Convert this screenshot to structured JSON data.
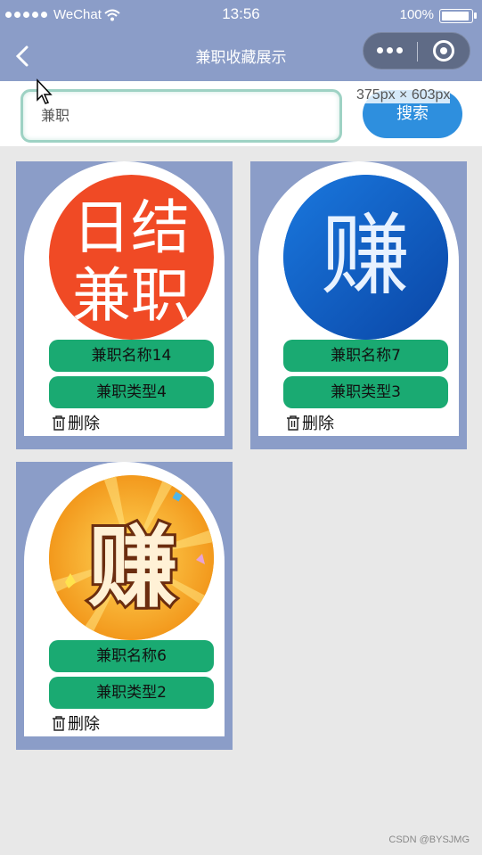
{
  "status_bar": {
    "carrier": "WeChat",
    "time": "13:56",
    "battery": "100%",
    "battery_level": 1.0,
    "icons": [
      "signal-dots-icon",
      "wifi-icon",
      "battery-icon"
    ]
  },
  "nav": {
    "title": "兼职收藏展示",
    "icons": [
      "back-icon",
      "more-icon",
      "close-icon"
    ]
  },
  "search": {
    "value": "兼职",
    "button_label": "搜索",
    "dim_label": "375px × 603px"
  },
  "items": [
    {
      "name": "兼职名称14",
      "type": "兼职类型4",
      "delete_label": "删除",
      "image_text": [
        "日结",
        "兼职"
      ],
      "image_bg": "#f04a25"
    },
    {
      "name": "兼职名称7",
      "type": "兼职类型3",
      "delete_label": "删除",
      "image_text": [
        "赚"
      ],
      "image_bg": "#0d5fc6"
    },
    {
      "name": "兼职名称6",
      "type": "兼职类型2",
      "delete_label": "删除",
      "image_text": [
        "赚"
      ],
      "image_bg": "#f5a516"
    }
  ],
  "watermark": "CSDN @BYSJMG",
  "colors": {
    "nav": "#8b9dc8",
    "pill": "#1aaa72",
    "search_button": "#2e8fde",
    "background": "#e8e8e8"
  }
}
